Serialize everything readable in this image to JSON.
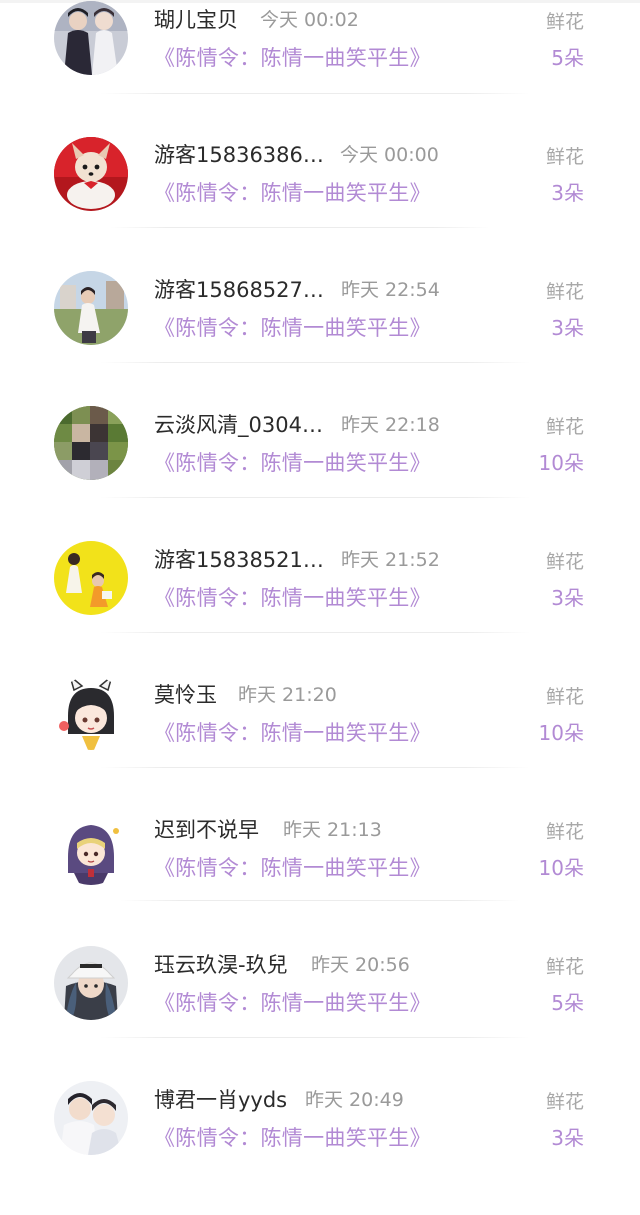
{
  "gift_list": {
    "items": [
      {
        "name": "瑚儿宝贝",
        "time": "今天 00:02",
        "book": "《陈情令：陈情一曲笑平生》",
        "gift_type": "鲜花",
        "count": "5朵",
        "avatar_icon": "couple-photo-avatar"
      },
      {
        "name": "游客15836386…",
        "time": "今天 00:00",
        "book": "《陈情令：陈情一曲笑平生》",
        "gift_type": "鲜花",
        "count": "3朵",
        "avatar_icon": "puppy-in-teacup-avatar"
      },
      {
        "name": "游客15868527…",
        "time": "昨天 22:54",
        "book": "《陈情令：陈情一曲笑平生》",
        "gift_type": "鲜花",
        "count": "3朵",
        "avatar_icon": "outdoor-person-avatar"
      },
      {
        "name": "云淡风清_0304…",
        "time": "昨天 22:18",
        "book": "《陈情令：陈情一曲笑平生》",
        "gift_type": "鲜花",
        "count": "10朵",
        "avatar_icon": "pixelated-person-avatar"
      },
      {
        "name": "游客15838521…",
        "time": "昨天 21:52",
        "book": "《陈情令：陈情一曲笑平生》",
        "gift_type": "鲜花",
        "count": "3朵",
        "avatar_icon": "yellow-background-child-avatar"
      },
      {
        "name": "莫怜玉",
        "time": "昨天 21:20",
        "book": "《陈情令：陈情一曲笑平生》",
        "gift_type": "鲜花",
        "count": "10朵",
        "avatar_icon": "anime-chibi-avatar"
      },
      {
        "name": "迟到不说早",
        "time": "昨天 21:13",
        "book": "《陈情令：陈情一曲笑平生》",
        "gift_type": "鲜花",
        "count": "10朵",
        "avatar_icon": "hooded-chibi-avatar"
      },
      {
        "name": "珏云玖淏-玖兒",
        "time": "昨天 20:56",
        "book": "《陈情令：陈情一曲笑平生》",
        "gift_type": "鲜花",
        "count": "5朵",
        "avatar_icon": "cap-girl-avatar"
      },
      {
        "name": "博君一肖yyds",
        "time": "昨天 20:49",
        "book": "《陈情令：陈情一曲笑平生》",
        "gift_type": "鲜花",
        "count": "3朵",
        "avatar_icon": "two-men-photo-avatar"
      }
    ]
  },
  "colors": {
    "accent_purple": "#b28ad4",
    "name_text": "#2b2b2b",
    "muted_text": "#9a9a9a"
  }
}
